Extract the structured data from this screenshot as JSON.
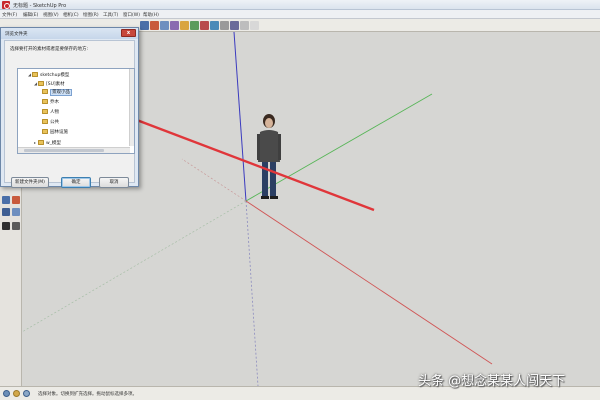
{
  "window": {
    "title": "无标题 - SketchUp Pro"
  },
  "menu": [
    "文件(F)",
    "编辑(E)",
    "视图(V)",
    "相机(C)",
    "绘图(R)",
    "工具(T)",
    "窗口(W)",
    "帮助(H)"
  ],
  "dialog": {
    "title": "浏览文件夹",
    "close_glyph": "x",
    "instruction": "选择要打开的素材或者是要保存的地方:",
    "tree": [
      {
        "label": "sketchup模型",
        "expander": "◢",
        "level": 0
      },
      {
        "label": "[SU]素材",
        "expander": "◢",
        "level": 1
      },
      {
        "label": "景观小品",
        "expander": "",
        "level": 2,
        "selected": true
      },
      {
        "label": "乔木",
        "expander": "",
        "level": 2
      },
      {
        "label": "人物",
        "expander": "",
        "level": 2
      },
      {
        "label": "公共",
        "expander": "",
        "level": 2
      },
      {
        "label": "园林设施",
        "expander": "",
        "level": 2
      },
      {
        "label": "w_模型",
        "expander": "▸",
        "level": 1
      }
    ],
    "new_folder_button": "新建文件夹(M)",
    "ok_button": "确定",
    "cancel_button": "取消"
  },
  "status": {
    "text": "选择对象。切换到扩充选择。拖动鼠标选择多项。"
  },
  "watermark": "头条 @想念某某人闯天下",
  "colors": {
    "viewport_bg": "#d6d6d3",
    "axis_blue": "#3b3bbf",
    "axis_green": "#57b557",
    "axis_red": "#d05555",
    "arrow": "#e0363a"
  },
  "icons": {
    "app": "sketchup-logo-icon",
    "folder": "folder-icon",
    "person": "scale-figure-person"
  }
}
